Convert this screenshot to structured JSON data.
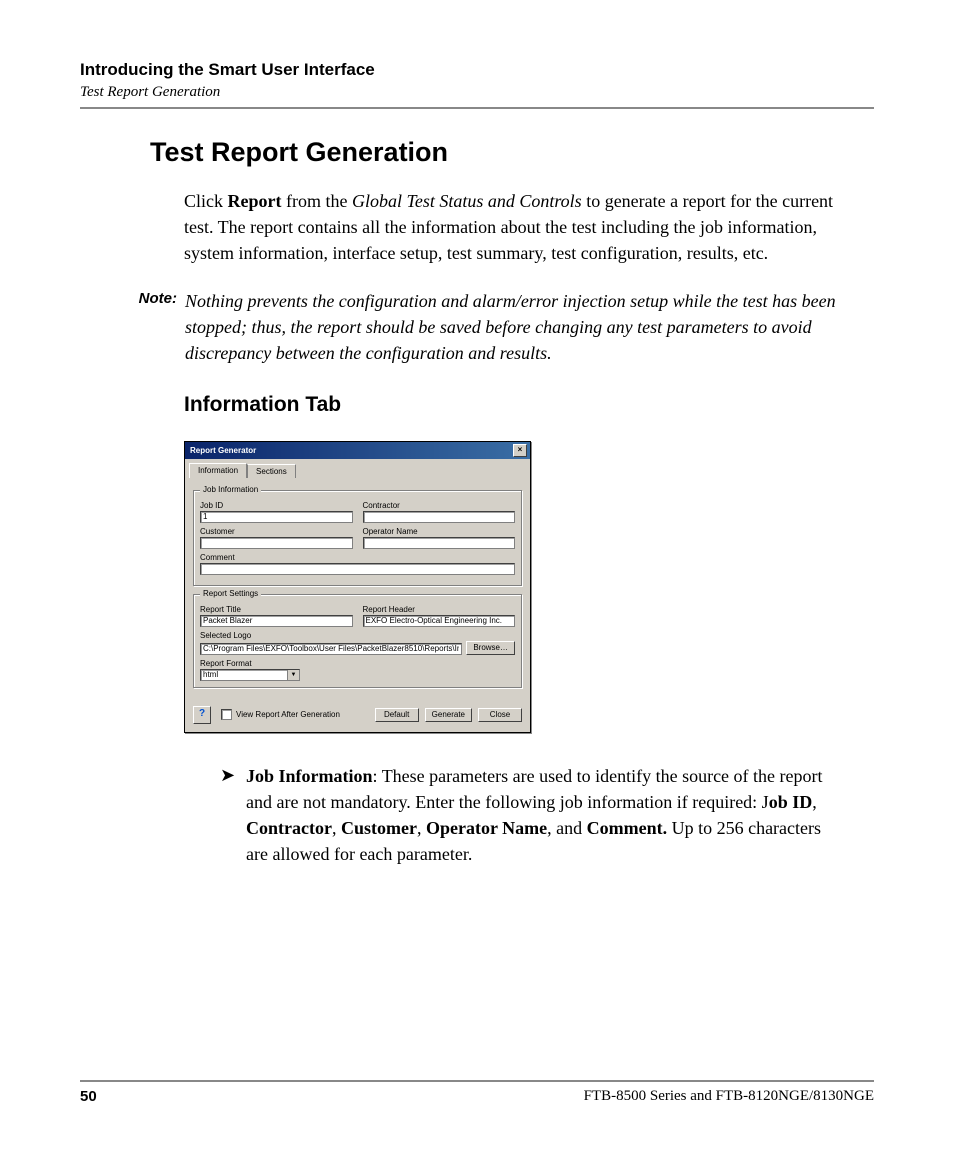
{
  "header": {
    "chapter": "Introducing the Smart User Interface",
    "subtitle": "Test Report Generation"
  },
  "section_title": "Test Report Generation",
  "paragraph_parts": {
    "p1_a": "Click ",
    "p1_b": "Report",
    "p1_c": " from the ",
    "p1_d": "Global Test Status and Controls",
    "p1_e": " to generate a report for the current test. The report contains all the information about the test including the job information, system information, interface setup, test summary, test configuration, results, etc."
  },
  "note_label": "Note:",
  "note_text": "Nothing prevents the configuration and alarm/error injection setup while the test has been stopped; thus, the report should be saved before changing any test parameters to avoid discrepancy between the configuration and results.",
  "subsection_title": "Information Tab",
  "dialog": {
    "title": "Report Generator",
    "close_glyph": "×",
    "tabs": {
      "information": "Information",
      "sections": "Sections"
    },
    "job_info": {
      "legend": "Job Information",
      "job_id_label": "Job ID",
      "job_id_value": "1",
      "contractor_label": "Contractor",
      "contractor_value": "",
      "customer_label": "Customer",
      "customer_value": "",
      "operator_label": "Operator Name",
      "operator_value": "",
      "comment_label": "Comment",
      "comment_value": ""
    },
    "report_settings": {
      "legend": "Report Settings",
      "title_label": "Report Title",
      "title_value": "Packet Blazer",
      "header_label": "Report Header",
      "header_value": "EXFO Electro-Optical Engineering Inc.",
      "logo_label": "Selected Logo",
      "logo_value": "C:\\Program Files\\EXFO\\Toolbox\\User Files\\PacketBlazer8510\\Reports\\Images\\Exfo.",
      "browse_label": "Browse…",
      "format_label": "Report Format",
      "format_value": "html"
    },
    "bottom": {
      "help_glyph": "?",
      "view_after_label": "View Report After Generation",
      "default_label": "Default",
      "generate_label": "Generate",
      "close_label": "Close"
    }
  },
  "bullet": {
    "arrow": "➤",
    "b1": "Job Information",
    "b2": ": These parameters are used to identify the source of the report and are not mandatory. Enter the following job information if required: J",
    "b3": "ob ID",
    "b4": ", ",
    "b5": "Contractor",
    "b6": ", ",
    "b7": "Customer",
    "b8": ", ",
    "b9": "Operator Name",
    "b10": ", and ",
    "b11": "Comment.",
    "b12": " Up to 256 characters are allowed for each parameter."
  },
  "footer": {
    "page": "50",
    "product": "FTB-8500 Series and FTB-8120NGE/8130NGE"
  }
}
